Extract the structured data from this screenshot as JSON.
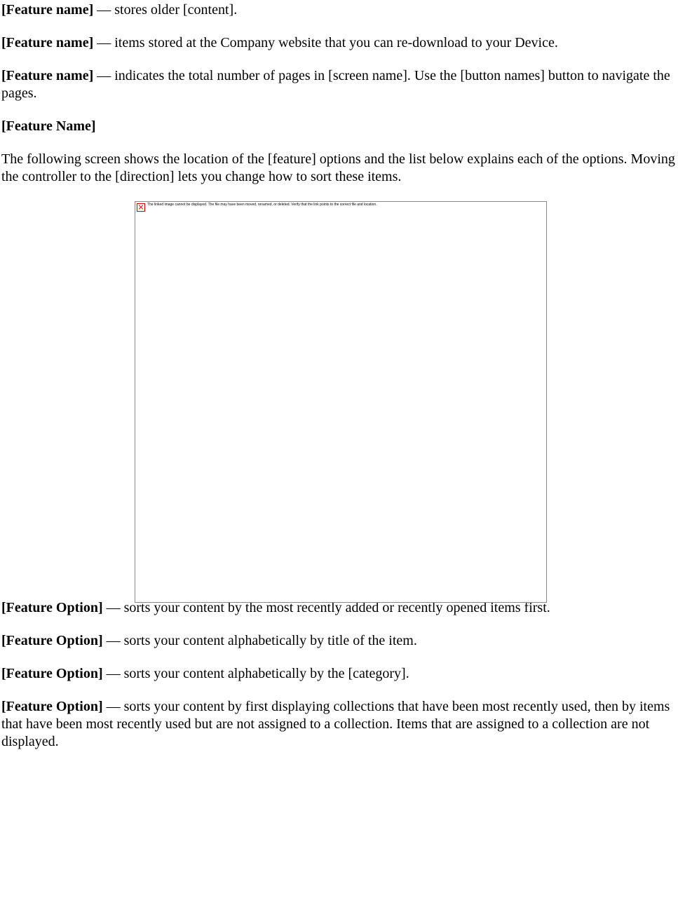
{
  "features": [
    {
      "name": "[Feature name]",
      "description": " — stores older [content]."
    },
    {
      "name": "[Feature name]",
      "description": " — items stored at the Company website that you can re-download to your Device."
    },
    {
      "name": "[Feature name]",
      "description": " — indicates the total number of pages in [screen name]. Use the [button names] button to navigate the pages."
    }
  ],
  "section_heading": "[Feature Name]",
  "section_intro": "The following screen shows the location of the [feature] options and the list below explains each of the options. Moving the controller to the [direction] lets you change how to sort these items.",
  "broken_image_alt": "The linked image cannot be displayed. The file may have been moved, renamed, or deleted. Verify that the link points to the correct file and location.",
  "options": [
    {
      "name": "[Feature Option]",
      "description": " — sorts your content by the most recently added or recently opened items first."
    },
    {
      "name": "[Feature Option]",
      "description": " — sorts your content alphabetically by title of the item."
    },
    {
      "name": "[Feature Option]",
      "description": " — sorts your content alphabetically by the [category]."
    },
    {
      "name": "[Feature Option]",
      "description": " — sorts your content by first displaying collections that have been most recently used, then by items that have been most recently used but are not assigned to a collection. Items that are assigned to a collection are not displayed."
    }
  ]
}
